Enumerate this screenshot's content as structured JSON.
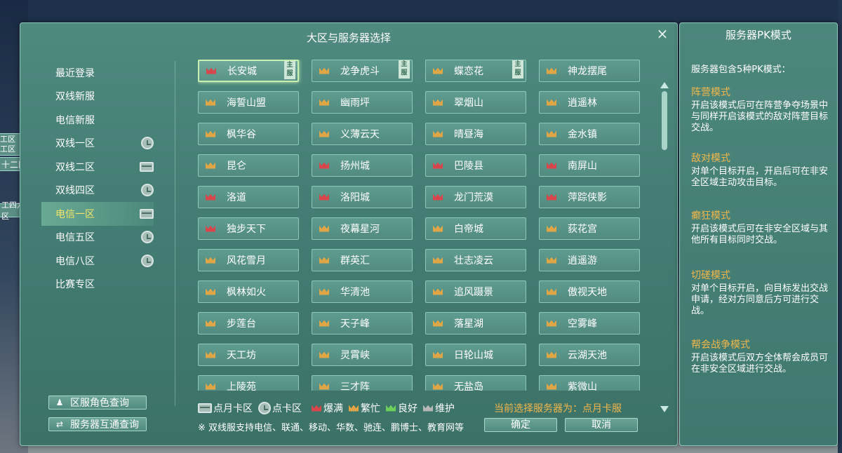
{
  "left_tabs": [
    {
      "label": "工区",
      "label2": "工区"
    },
    {
      "label": "十二区"
    },
    {
      "label": "工四六七区"
    }
  ],
  "main": {
    "title": "大区与服务器选择",
    "close_icon": "×",
    "regions": [
      {
        "label": "最近登录",
        "icon": ""
      },
      {
        "label": "双线新服",
        "icon": ""
      },
      {
        "label": "电信新服",
        "icon": ""
      },
      {
        "label": "双线一区",
        "icon": "clock-icon"
      },
      {
        "label": "双线二区",
        "icon": "card-icon"
      },
      {
        "label": "双线四区",
        "icon": "clock-icon"
      },
      {
        "label": "电信一区",
        "icon": "card-icon",
        "active": true
      },
      {
        "label": "电信五区",
        "icon": "clock-icon"
      },
      {
        "label": "电信八区",
        "icon": "clock-icon"
      },
      {
        "label": "比赛专区",
        "icon": ""
      }
    ],
    "servers": [
      {
        "name": "长安城",
        "status": "red",
        "main": true,
        "selected": true
      },
      {
        "name": "龙争虎斗",
        "status": "orange",
        "main": true
      },
      {
        "name": "蝶恋花",
        "status": "orange",
        "main": true
      },
      {
        "name": "神龙摆尾",
        "status": "orange"
      },
      {
        "name": "海誓山盟",
        "status": "orange"
      },
      {
        "name": "幽雨坪",
        "status": "orange"
      },
      {
        "name": "翠烟山",
        "status": "orange"
      },
      {
        "name": "逍遥林",
        "status": "orange"
      },
      {
        "name": "枫华谷",
        "status": "orange"
      },
      {
        "name": "义薄云天",
        "status": "orange"
      },
      {
        "name": "晴昼海",
        "status": "orange"
      },
      {
        "name": "金水镇",
        "status": "orange"
      },
      {
        "name": "昆仑",
        "status": "orange"
      },
      {
        "name": "扬州城",
        "status": "red"
      },
      {
        "name": "巴陵县",
        "status": "red"
      },
      {
        "name": "南屏山",
        "status": "red"
      },
      {
        "name": "洛道",
        "status": "red"
      },
      {
        "name": "洛阳城",
        "status": "red"
      },
      {
        "name": "龙门荒漠",
        "status": "red"
      },
      {
        "name": "萍踪侠影",
        "status": "red"
      },
      {
        "name": "独步天下",
        "status": "red"
      },
      {
        "name": "夜幕星河",
        "status": "orange"
      },
      {
        "name": "白帝城",
        "status": "orange"
      },
      {
        "name": "荻花宫",
        "status": "orange"
      },
      {
        "name": "风花雪月",
        "status": "orange"
      },
      {
        "name": "群英汇",
        "status": "orange"
      },
      {
        "name": "壮志凌云",
        "status": "orange"
      },
      {
        "name": "逍遥游",
        "status": "orange"
      },
      {
        "name": "枫林如火",
        "status": "orange"
      },
      {
        "name": "华清池",
        "status": "orange"
      },
      {
        "name": "追风蹑景",
        "status": "orange"
      },
      {
        "name": "傲视天地",
        "status": "orange"
      },
      {
        "name": "步莲台",
        "status": "orange"
      },
      {
        "name": "天子峰",
        "status": "orange"
      },
      {
        "name": "落星湖",
        "status": "orange"
      },
      {
        "name": "空雾峰",
        "status": "orange"
      },
      {
        "name": "天工坊",
        "status": "orange"
      },
      {
        "name": "灵霄峡",
        "status": "orange"
      },
      {
        "name": "日轮山城",
        "status": "orange"
      },
      {
        "name": "云湖天池",
        "status": "orange"
      },
      {
        "name": "上陵苑",
        "status": "orange"
      },
      {
        "name": "三才阵",
        "status": "orange"
      },
      {
        "name": "无盐岛",
        "status": "orange"
      },
      {
        "name": "紫微山",
        "status": "orange"
      }
    ],
    "main_tag": "主服",
    "query_role": "区服角色查询",
    "query_interop": "服务器互通查询",
    "legend": {
      "card": "点月卡区",
      "clock": "点卡区",
      "full": "爆满",
      "busy": "繁忙",
      "good": "良好",
      "maint": "维护"
    },
    "current_selection": "当前选择服务器为：点月卡服",
    "note": "※ 双线服支持电信、联通、移动、华数、驰连、鹏博士、教育网等",
    "confirm": "确定",
    "cancel": "取消",
    "colors": {
      "full": "#d8464c",
      "busy": "#e0a646",
      "good": "#6ccf5a",
      "maint": "#b7b7b7"
    }
  },
  "pk": {
    "title": "服务器PK模式",
    "intro": "服务器包含5种PK模式：",
    "modes": [
      {
        "name": "阵营模式",
        "desc": "开启该模式后可在阵营争夺场景中与同样开启该模式的敌对阵营目标交战。"
      },
      {
        "name": "敌对模式",
        "desc": "对单个目标开启，开启后可在非安全区域主动攻击目标。"
      },
      {
        "name": "癫狂模式",
        "desc": "开启该模式后可在非安全区域与其他所有目标同时交战。"
      },
      {
        "name": "切磋模式",
        "desc": "对单个目标开启，向目标发出交战申请，经对方同意后方可进行交战。"
      },
      {
        "name": "帮会战争模式",
        "desc": "开启该模式后双方全体帮会成员可在非安全区域进行交战。"
      }
    ]
  }
}
